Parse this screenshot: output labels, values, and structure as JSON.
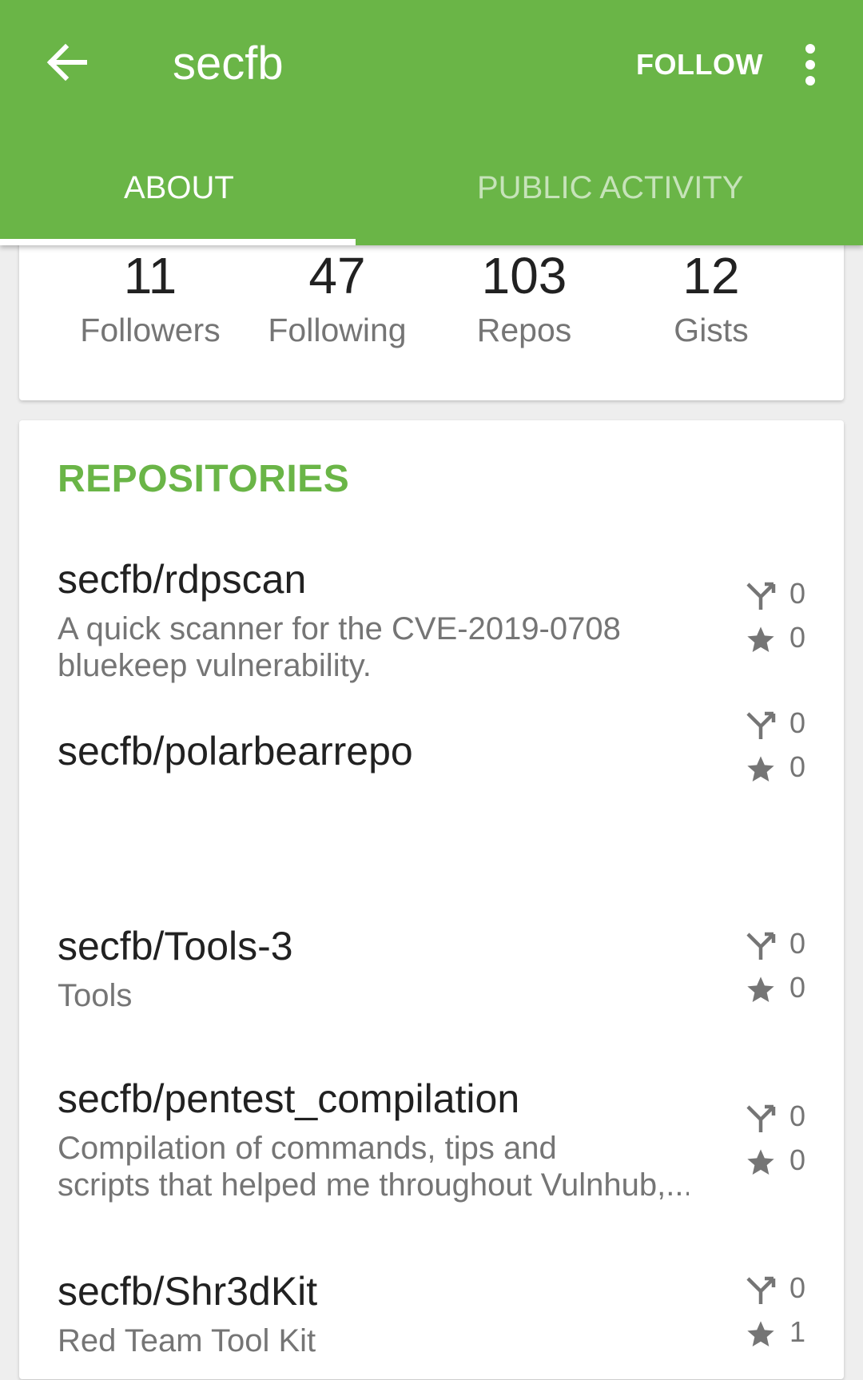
{
  "app_bar": {
    "title": "secfb",
    "follow_label": "FOLLOW",
    "tabs": [
      {
        "label": "ABOUT",
        "active": true
      },
      {
        "label": "PUBLIC ACTIVITY",
        "active": false
      }
    ]
  },
  "stats": [
    {
      "count": "11",
      "label": "Followers"
    },
    {
      "count": "47",
      "label": "Following"
    },
    {
      "count": "103",
      "label": "Repos"
    },
    {
      "count": "12",
      "label": "Gists"
    }
  ],
  "repositories": {
    "title": "REPOSITORIES",
    "items": [
      {
        "name": "secfb/rdpscan",
        "description_lines": [
          "A quick scanner for the CVE-2019-0708",
          "bluekeep vulnerability."
        ],
        "forks": "0",
        "stars": "0"
      },
      {
        "name": "secfb/polarbearrepo",
        "description_lines": [],
        "forks": "0",
        "stars": "0"
      },
      {
        "name": "secfb/Tools-3",
        "description_lines": [
          "Tools"
        ],
        "forks": "0",
        "stars": "0"
      },
      {
        "name": "secfb/pentest_compilation",
        "description_lines": [
          "Compilation of commands, tips and",
          "scripts that helped me throughout Vulnhub,..."
        ],
        "forks": "0",
        "stars": "0"
      },
      {
        "name": "secfb/Shr3dKit",
        "description_lines": [
          "Red Team Tool Kit"
        ],
        "forks": "0",
        "stars": "1"
      }
    ]
  },
  "colors": {
    "primary": "#6ab547",
    "text_primary": "#212121",
    "text_secondary": "#757575",
    "background": "#eeeeee"
  },
  "icons": {
    "back": "arrow-left-icon",
    "more": "more-vertical-icon",
    "fork": "fork-icon",
    "star": "star-icon"
  }
}
